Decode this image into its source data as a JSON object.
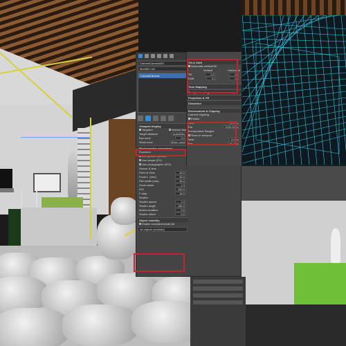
{
  "panel": {
    "camera_name": "CameraCamera001",
    "modifier_list": "Modifier List",
    "selected_item": "CoronaCamera",
    "sections_left": {
      "viewport_display": {
        "title": "Viewport display",
        "targeted": "Targeted",
        "horizon": "Horizon line",
        "target_distance_label": "Target distance",
        "target_distance_value": "Auto/Man",
        "fov_label": "Eye.zone",
        "fov_value": "0.0",
        "show_cone_label": "Show cone",
        "show_cone_value": "When used"
      },
      "photographic": {
        "title": "Photographic parameters",
        "exposure_label": "Exposure",
        "use_global": "Use global exposure",
        "use_simple": "Use simple (EV)",
        "use_photo": "Use photographic (ISO)",
        "sensor_label": "Sensor & lens",
        "fov_row": "Field of View",
        "fov_val": "45.0",
        "focal_row": "Focal L. (mm)",
        "focal_val": "35.0",
        "film_row": "Film width (mm)",
        "film_val": "36.0",
        "zoom_row": "Zoom factor",
        "zoom_val": "1.0",
        "iso_row": "ISO",
        "iso_val": "100.0",
        "fstop_row": "F-stop",
        "fstop_val": "16.0",
        "shutter_label": "Shutter",
        "shutter_speed": "Shutter speed",
        "shutter_speed_val": "1.0",
        "shutter_angle": "Shutter angle",
        "shutter_angle_val": "180.0",
        "motion_duration": "Motion duration",
        "motion_val": "0.5",
        "shutter_offset": "Shutter offset",
        "offset_val": "0.0"
      },
      "override": {
        "title": "Object visibility",
        "row1": "Enable exclude/include list",
        "row2": "All objects (exclude)"
      }
    },
    "sections_right": {
      "tilt_shift": {
        "title": "Tilt & Shift",
        "auto_vertical": "Automatic vertical tilt",
        "col_vertical": "Vertical",
        "col_horizontal": "Horizontal",
        "tilt_label": "Tilt",
        "tilt_v": "0.0",
        "tilt_h": "0.0",
        "shift_label": "Shift",
        "shift_v": "0.0",
        "shift_h": "0.0"
      },
      "collapsed": [
        "Tone Mapping",
        "Postprocessing",
        "Projection & VR",
        "Distortion"
      ],
      "env": {
        "title": "Environment & Clipping",
        "camera_clipping": "Camera Clipping",
        "enable": "Enable",
        "near_label": "Near",
        "near_val": "30.0cm",
        "far_label": "Far",
        "far_val": "1000.00cm",
        "env_ranges": "Environment Ranges",
        "show_in_viewport": "Show in viewport",
        "near2_label": "Near",
        "near2_val": "0.0cm",
        "far2_label": "Far",
        "far2_val": "100.0cm"
      }
    }
  },
  "colors": {
    "highlight": "#c0262d",
    "selection": "#3b6fb0",
    "wireframe": "#35c8e8",
    "panel_bg": "#444444"
  }
}
